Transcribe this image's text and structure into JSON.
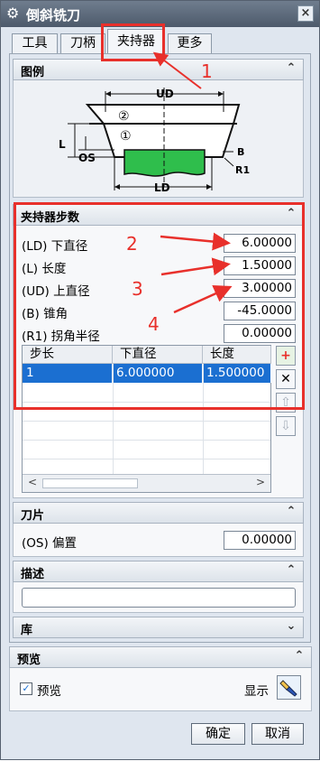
{
  "window": {
    "title": "倒斜铣刀"
  },
  "tabs": [
    {
      "label": "工具"
    },
    {
      "label": "刀柄"
    },
    {
      "label": "夹持器"
    },
    {
      "label": "更多"
    }
  ],
  "figure_section": {
    "title": "图例",
    "diagram_labels": {
      "ud": "UD",
      "ld": "LD",
      "l": "L",
      "os": "OS",
      "b": "B",
      "r1": "R1",
      "circle1": "①",
      "circle2": "②"
    }
  },
  "holder_steps": {
    "title": "夹持器步数",
    "params": [
      {
        "label": "(LD) 下直径",
        "value": "6.00000"
      },
      {
        "label": "(L) 长度",
        "value": "1.50000"
      },
      {
        "label": "(UD) 上直径",
        "value": "3.00000"
      },
      {
        "label": "(B) 锥角",
        "value": "-45.0000"
      },
      {
        "label": "(R1) 拐角半径",
        "value": "0.00000"
      }
    ],
    "table": {
      "columns": [
        "步长",
        "下直径",
        "长度"
      ],
      "rows": [
        [
          "1",
          "6.000000",
          "1.500000"
        ]
      ]
    }
  },
  "blade_section": {
    "title": "刀片",
    "offset_label": "(OS) 偏置",
    "offset_value": "0.00000"
  },
  "desc_section": {
    "title": "描述",
    "value": ""
  },
  "library_section": {
    "title": "库"
  },
  "preview_section": {
    "title": "预览",
    "checkbox_label": "预览",
    "checked": true,
    "show_label": "显示"
  },
  "footer": {
    "ok_label": "确定",
    "cancel_label": "取消"
  },
  "annotations": [
    "1",
    "2",
    "3",
    "4"
  ],
  "colors": {
    "annotation_red": "#e8302b",
    "selection_blue": "#1b6fd1",
    "holder_green": "#2fbe4c"
  }
}
